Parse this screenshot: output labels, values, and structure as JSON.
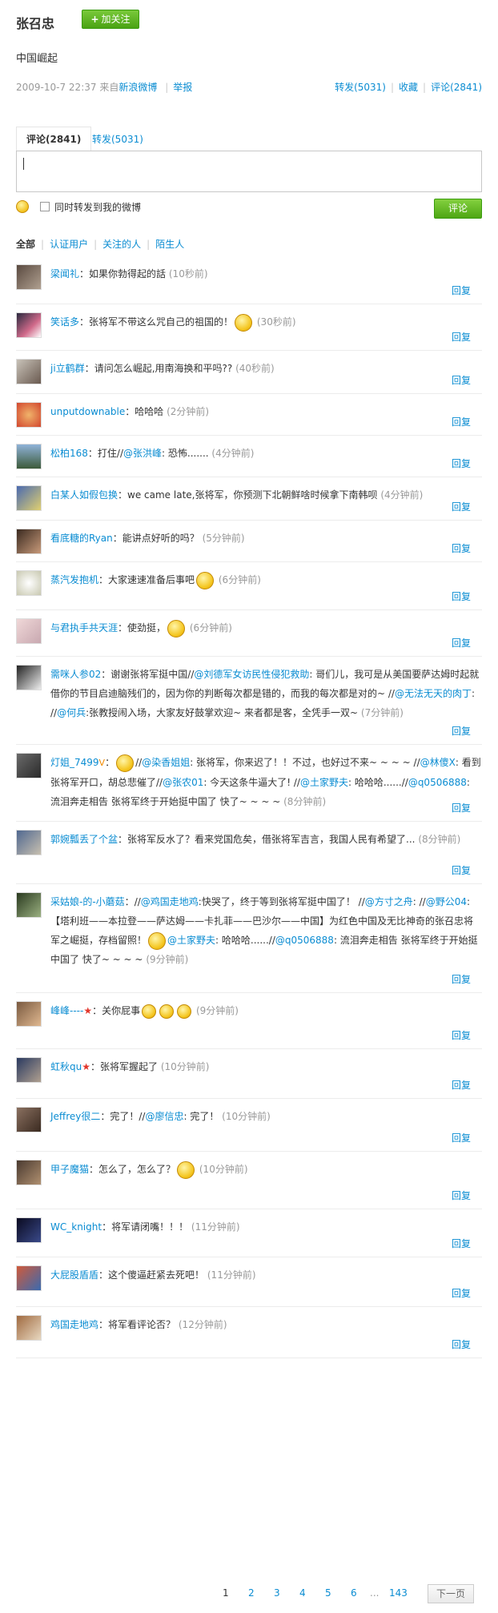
{
  "post": {
    "author": "张召忠",
    "follow_label": "加关注",
    "text": "中国崛起",
    "datetime": "2009-10-7 22:37",
    "source_prefix": "来自",
    "source": "新浪微博",
    "report": "举报",
    "forward": "转发(5031)",
    "favorite": "收藏",
    "comment": "评论(2841)"
  },
  "comment_tabs": {
    "active": "评论(2841)",
    "other": "转发(5031)"
  },
  "comment_box": {
    "placeholder": "",
    "also_forward_label": "同时转发到我的微博",
    "submit_label": "评论"
  },
  "filters": [
    "全部",
    "认证用户",
    "关注的人",
    "陌生人"
  ],
  "reply_label": "回复",
  "comments": [
    {
      "name": "梁闻礼",
      "text": "如果你勃得起的話",
      "time": "(10秒前)"
    },
    {
      "name": "笑话多",
      "text": "张将军不带这么咒自己的祖国的！",
      "time": "(30秒前)"
    },
    {
      "name": "ji立鹤群",
      "text": "请问怎么崛起,用南海换和平吗??",
      "time": "(40秒前)"
    },
    {
      "name": "unputdownable",
      "text": "哈哈哈",
      "time": "(2分钟前)"
    },
    {
      "name": "松柏168",
      "text_pre": "打住//",
      "mention": "@张洪峰",
      "text": ": 恐怖.......",
      "time": "(4分钟前)"
    },
    {
      "name": "白某人如假包换",
      "text": "we came late,张将军，你预测下北朝鲜啥时候拿下南韩呗",
      "time": "(4分钟前)"
    },
    {
      "name": "看底糖的Ryan",
      "text": "能讲点好听的吗？",
      "time": "(5分钟前)"
    },
    {
      "name": "蒸汽发抱机",
      "text": "大家速速准备后事吧",
      "time": "(6分钟前)"
    },
    {
      "name": "与君执手共天涯",
      "text": "使劲挺，",
      "time": "(6分钟前)"
    },
    {
      "name": "需咪人参02",
      "text_pre": "谢谢张将军挺中国//",
      "mention": "@刘德军女访民性侵犯救助",
      "text": ": 哥们儿，我可是从美国要萨达姆时起就借你的节目启迪脑残们的，因为你的判断每次都是错的，而我的每次都是对的~ //",
      "mention2": "@无法无天的肉丁",
      "text2": ": //",
      "mention3": "@何兵",
      "text3": ":张教授闹入场，大家友好鼓掌欢迎~ 来者都是客，全凭手一双~",
      "time": "(7分钟前)"
    },
    {
      "name": "灯姐_7499",
      "text_pre": "//",
      "mention": "@染香姐姐",
      "text": ": 张将军，你来迟了！！不过，也好过不来~ ~ ~ ~ //",
      "mention2": "@林傻X",
      "text2": ": 看到张将军开口，胡总悲催了//",
      "mention3": "@张农01",
      "text3": ": 今天这条牛逼大了! //",
      "mention4": "@土家野夫",
      "text4": ": 哈哈哈......//",
      "mention5": "@q0506888",
      "text5": ": 流泪奔走相告 张将军终于开始挺中国了 快了~ ~ ~ ~",
      "time": "(8分钟前)"
    },
    {
      "name": "郭婉瓢丢了个盆",
      "text": "张将军反水了？看来党国危矣，借张将军吉言，我国人民有希望了...",
      "time": "(8分钟前)"
    },
    {
      "name": "采姑娘-的-小蘑菇",
      "text_pre": "//",
      "mention": "@鸡国走地鸡",
      "text": ":快哭了，终于等到张将军挺中国了！ //",
      "mention2": "@方寸之舟",
      "text2": ": //",
      "mention3": "@野公04",
      "text3": ": 【塔利班——本拉登——萨达姆——卡扎菲——巴沙尔——中国】为红色中国及无比神奇的张召忠将军之崛挺，存档留照！",
      "mention4": "@土家野夫",
      "text4": ": 哈哈哈......//",
      "mention5": "@q0506888",
      "text5": ": 流泪奔走相告 张将军终于开始挺中国了 快了~ ~ ~ ~",
      "time": "(9分钟前)"
    },
    {
      "name": "峰峰----",
      "text": "关你屁事",
      "time": "(9分钟前)"
    },
    {
      "name": "虹秋qu",
      "text": "张将军握起了",
      "time": "(10分钟前)"
    },
    {
      "name": "Jeffrey很二",
      "text_pre": "完了！//",
      "mention": "@廖信忠",
      "text": ": 完了！",
      "time": "(10分钟前)"
    },
    {
      "name": "甲子魔猫",
      "text": "怎么了，怎么了？",
      "time": "(10分钟前)"
    },
    {
      "name": "WC_knight",
      "text": "将军请闭嘴！！！",
      "time": "(11分钟前)"
    },
    {
      "name": "大屁股盾盾",
      "text": "这个傻逼赶紧去死吧！",
      "time": "(11分钟前)"
    },
    {
      "name": "鸡国走地鸡",
      "text": "将军看评论否？",
      "time": "(12分钟前)"
    }
  ],
  "pager": {
    "pages": [
      "1",
      "2",
      "3",
      "4",
      "5",
      "6"
    ],
    "ellipsis": "...",
    "last": "143",
    "next": "下一页"
  },
  "colors": {
    "link": "#0a8cd2",
    "green_button": "#4ea614",
    "meta": "#999999"
  }
}
